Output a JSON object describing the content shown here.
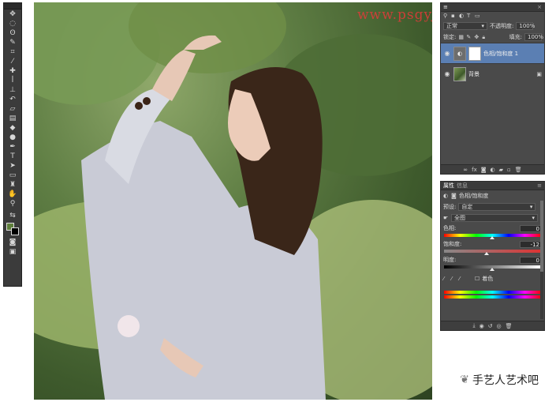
{
  "watermark": "www.psgyjia.com",
  "wechat_account": "手艺人艺术吧",
  "layers_panel": {
    "blend_mode": "正常",
    "opacity_label": "不透明度:",
    "opacity_value": "100%",
    "lock_label": "锁定:",
    "fill_label": "填充:",
    "fill_value": "100%",
    "layers": [
      {
        "name": "色相/饱和度 1",
        "selected": true
      },
      {
        "name": "背景",
        "selected": false
      }
    ]
  },
  "properties_panel": {
    "tabs": [
      "属性",
      "信息"
    ],
    "adjustment_name": "色相/饱和度",
    "preset_label": "预设:",
    "preset_value": "自定",
    "channel_value": "全图",
    "hue_label": "色相:",
    "hue_value": "0",
    "saturation_label": "饱和度:",
    "saturation_value": "-12",
    "lightness_label": "明度:",
    "lightness_value": "0",
    "colorize_label": "着色"
  },
  "colors": {
    "panel_bg": "#4a4a4a",
    "selected_layer": "#5b7fb3",
    "watermark": "#e23a3a",
    "foreground_swatch": "#5f7f3b",
    "background_swatch": "#000000"
  }
}
